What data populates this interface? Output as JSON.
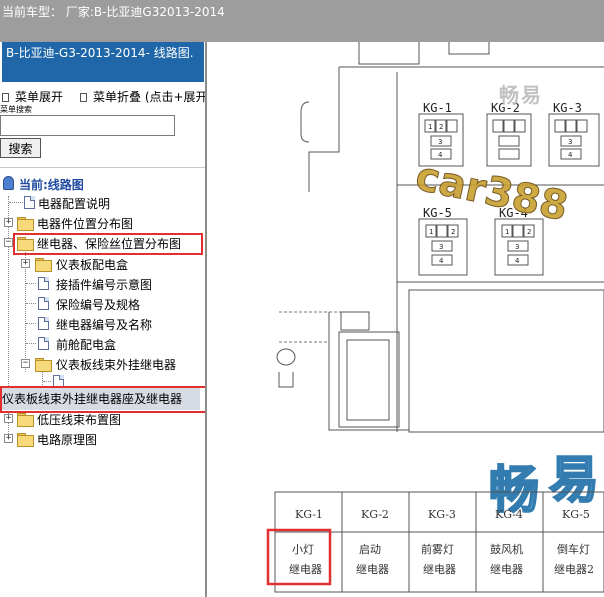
{
  "topbar": {
    "text": "当前车型： 厂家:B-比亚迪G32013-2014"
  },
  "panel": {
    "doc_title": "B-比亚迪-G3-2013-2014- 线路图.",
    "expand_menu": "菜单展开",
    "collapse_menu": "菜单折叠 (点击+展开",
    "search_label": "菜单搜索",
    "search_value": "",
    "search_button": "搜索",
    "tree": [
      {
        "label": "当前:线路图"
      },
      {
        "label": "电器配置说明"
      },
      {
        "label": "电器件位置分布图"
      },
      {
        "label": "继电器、保险丝位置分布图"
      },
      {
        "label": "仪表板配电盒"
      },
      {
        "label": "接插件编号示意图"
      },
      {
        "label": "保险编号及规格"
      },
      {
        "label": "继电器编号及名称"
      },
      {
        "label": "前舱配电盒"
      },
      {
        "label": "仪表板线束外挂继电器"
      },
      {
        "label": "仪表板线束外挂继电器座及继电器"
      },
      {
        "label": "低压线束布置图"
      },
      {
        "label": "电路原理图"
      }
    ]
  },
  "diagram": {
    "relays_top": [
      "KG-1",
      "KG-2",
      "KG-3"
    ],
    "relays_mid": [
      "KG-5",
      "KG-4"
    ],
    "pins": [
      "1",
      "2",
      "3",
      "4"
    ],
    "watermark": {
      "chang": "畅",
      "yi": "易"
    },
    "table": {
      "headers": [
        "KG-1",
        "KG-2",
        "KG-3",
        "KG-4",
        "KG-5"
      ],
      "rows": [
        [
          "小灯",
          "启动",
          "前雾灯",
          "鼓风机",
          "倒车灯"
        ],
        [
          "继电器",
          "继电器",
          "继电器",
          "继电器",
          "继电器2"
        ]
      ]
    }
  },
  "colors": {
    "accent": "#1f67a8",
    "highlight": "#e23030",
    "watermark": "#2f8fce"
  }
}
